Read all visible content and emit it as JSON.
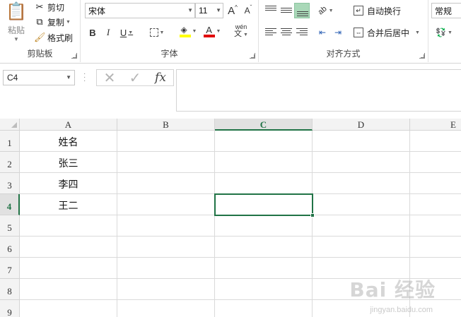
{
  "ribbon": {
    "clipboard": {
      "paste_label": "粘贴",
      "cut_label": "剪切",
      "copy_label": "复制",
      "format_painter_label": "格式刷",
      "group_label": "剪贴板"
    },
    "font": {
      "font_name": "宋体",
      "font_size": "11",
      "increase_size": "A",
      "decrease_size": "A",
      "bold": "B",
      "italic": "I",
      "underline": "U",
      "phonetic": "wén",
      "font_color_letter": "A",
      "font_color": "#e00000",
      "fill_color": "#ffff00",
      "group_label": "字体"
    },
    "alignment": {
      "wrap_text_label": "自动换行",
      "merge_center_label": "合并后居中",
      "group_label": "对齐方式"
    },
    "number": {
      "format_value": "常规"
    }
  },
  "formula_bar": {
    "name_box": "C4",
    "cancel_icon": "✕",
    "enter_icon": "✓",
    "fx_label": "fx",
    "formula_value": ""
  },
  "sheet": {
    "columns": [
      "A",
      "B",
      "C",
      "D",
      "E"
    ],
    "rows": [
      "1",
      "2",
      "3",
      "4",
      "5",
      "6",
      "7",
      "8",
      "9"
    ],
    "active_cell": "C4",
    "cells": {
      "A1": "姓名",
      "A2": "张三",
      "A3": "李四",
      "A4": "王二"
    }
  },
  "watermark": {
    "text": "Bai 经验",
    "sub": "jingyan.baidu.com"
  },
  "colors": {
    "accent": "#217346",
    "header_bg": "#f3f3f3",
    "grid_line": "#dadada"
  }
}
